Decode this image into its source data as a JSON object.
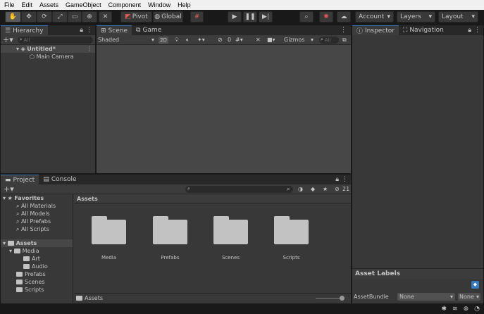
{
  "menu": [
    "File",
    "Edit",
    "Assets",
    "GameObject",
    "Component",
    "Window",
    "Help"
  ],
  "toolbar": {
    "pivot_label": "Pivot",
    "global_label": "Global",
    "account_label": "Account",
    "layers_label": "Layers",
    "layout_label": "Layout"
  },
  "hierarchy": {
    "tab_label": "Hierarchy",
    "search_placeholder": "All",
    "scene_name": "Untitled*",
    "items": [
      "Main Camera"
    ]
  },
  "scene": {
    "tabs": [
      "Scene",
      "Game"
    ],
    "shading_mode": "Shaded",
    "mode_2d": "2D",
    "hidden_count": "0",
    "gizmos_label": "Gizmos",
    "search_placeholder": "All"
  },
  "inspector": {
    "tabs": [
      "Inspector",
      "Navigation"
    ],
    "asset_labels_title": "Asset Labels",
    "assetbundle_label": "AssetBundle",
    "assetbundle_value": "None",
    "variant_value": "None"
  },
  "project": {
    "tabs": [
      "Project",
      "Console"
    ],
    "hidden_count": "21",
    "favorites_label": "Favorites",
    "favorites": [
      "All Materials",
      "All Models",
      "All Prefabs",
      "All Scripts"
    ],
    "assets_label": "Assets",
    "tree": [
      {
        "label": "Media",
        "depth": 1,
        "expanded": true
      },
      {
        "label": "Art",
        "depth": 2
      },
      {
        "label": "Audio",
        "depth": 2
      },
      {
        "label": "Prefabs",
        "depth": 1
      },
      {
        "label": "Scenes",
        "depth": 1
      },
      {
        "label": "Scripts",
        "depth": 1
      }
    ],
    "breadcrumb": "Assets",
    "grid_items": [
      "Media",
      "Prefabs",
      "Scenes",
      "Scripts"
    ],
    "footer_path": "Assets"
  },
  "colors": {
    "accent": "#3a79bb",
    "panel": "#383838",
    "toolbar": "#191919",
    "viewport": "#474747"
  }
}
